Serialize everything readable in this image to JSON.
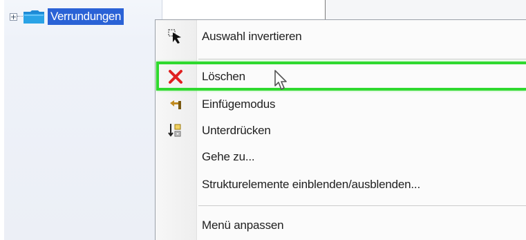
{
  "tree": {
    "expander_symbol": "+",
    "node_label": "Verrundungen",
    "folder_icon": "folder-icon",
    "folder_color": "#2aa3e6"
  },
  "context_menu": {
    "items": [
      {
        "label": "Auswahl invertieren",
        "icon": "select-arrow-icon"
      },
      {
        "label": "Löschen",
        "icon": "delete-x-icon",
        "icon_color": "#e02020",
        "highlighted": true
      },
      {
        "label": "Einfügemodus",
        "icon": "insert-mode-icon"
      },
      {
        "label": "Unterdrücken",
        "icon": "suppress-icon"
      },
      {
        "label": "Gehe zu...",
        "icon": ""
      },
      {
        "label": "Strukturelemente einblenden/ausblenden...",
        "icon": ""
      },
      {
        "label": "Menü anpassen",
        "icon": ""
      }
    ],
    "highlight_color": "#2fd92f"
  }
}
